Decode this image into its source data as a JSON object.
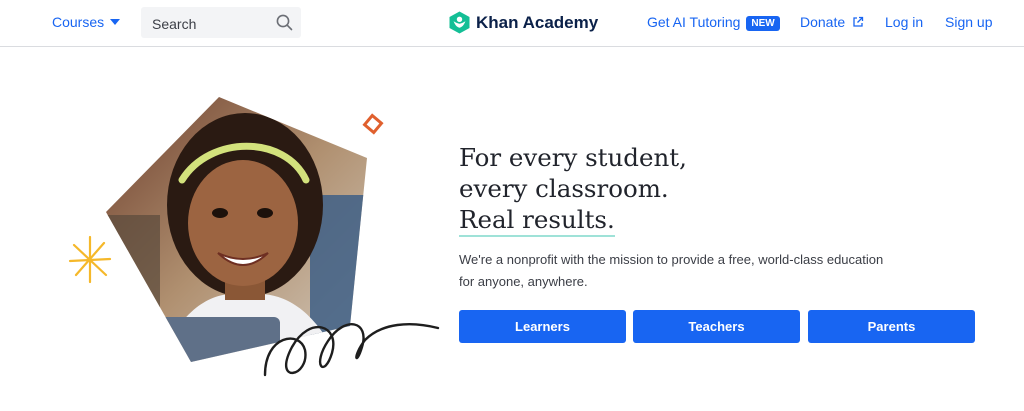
{
  "header": {
    "courses_label": "Courses",
    "search_placeholder": "Search",
    "logo_text": "Khan Academy",
    "ai_tutoring_label": "Get AI Tutoring",
    "new_badge": "NEW",
    "donate_label": "Donate",
    "login_label": "Log in",
    "signup_label": "Sign up"
  },
  "hero": {
    "headline_line1": "For every student,",
    "headline_line2": "every classroom.",
    "headline_line3": "Real results.",
    "mission": "We're a nonprofit with the mission to provide a free, world-class education for anyone, anywhere.",
    "buttons": [
      "Learners",
      "Teachers",
      "Parents"
    ]
  },
  "colors": {
    "brand_blue": "#1865f2",
    "logo_green": "#14bf96",
    "navy": "#0b2149",
    "underline_mint": "#9fe2d8"
  }
}
